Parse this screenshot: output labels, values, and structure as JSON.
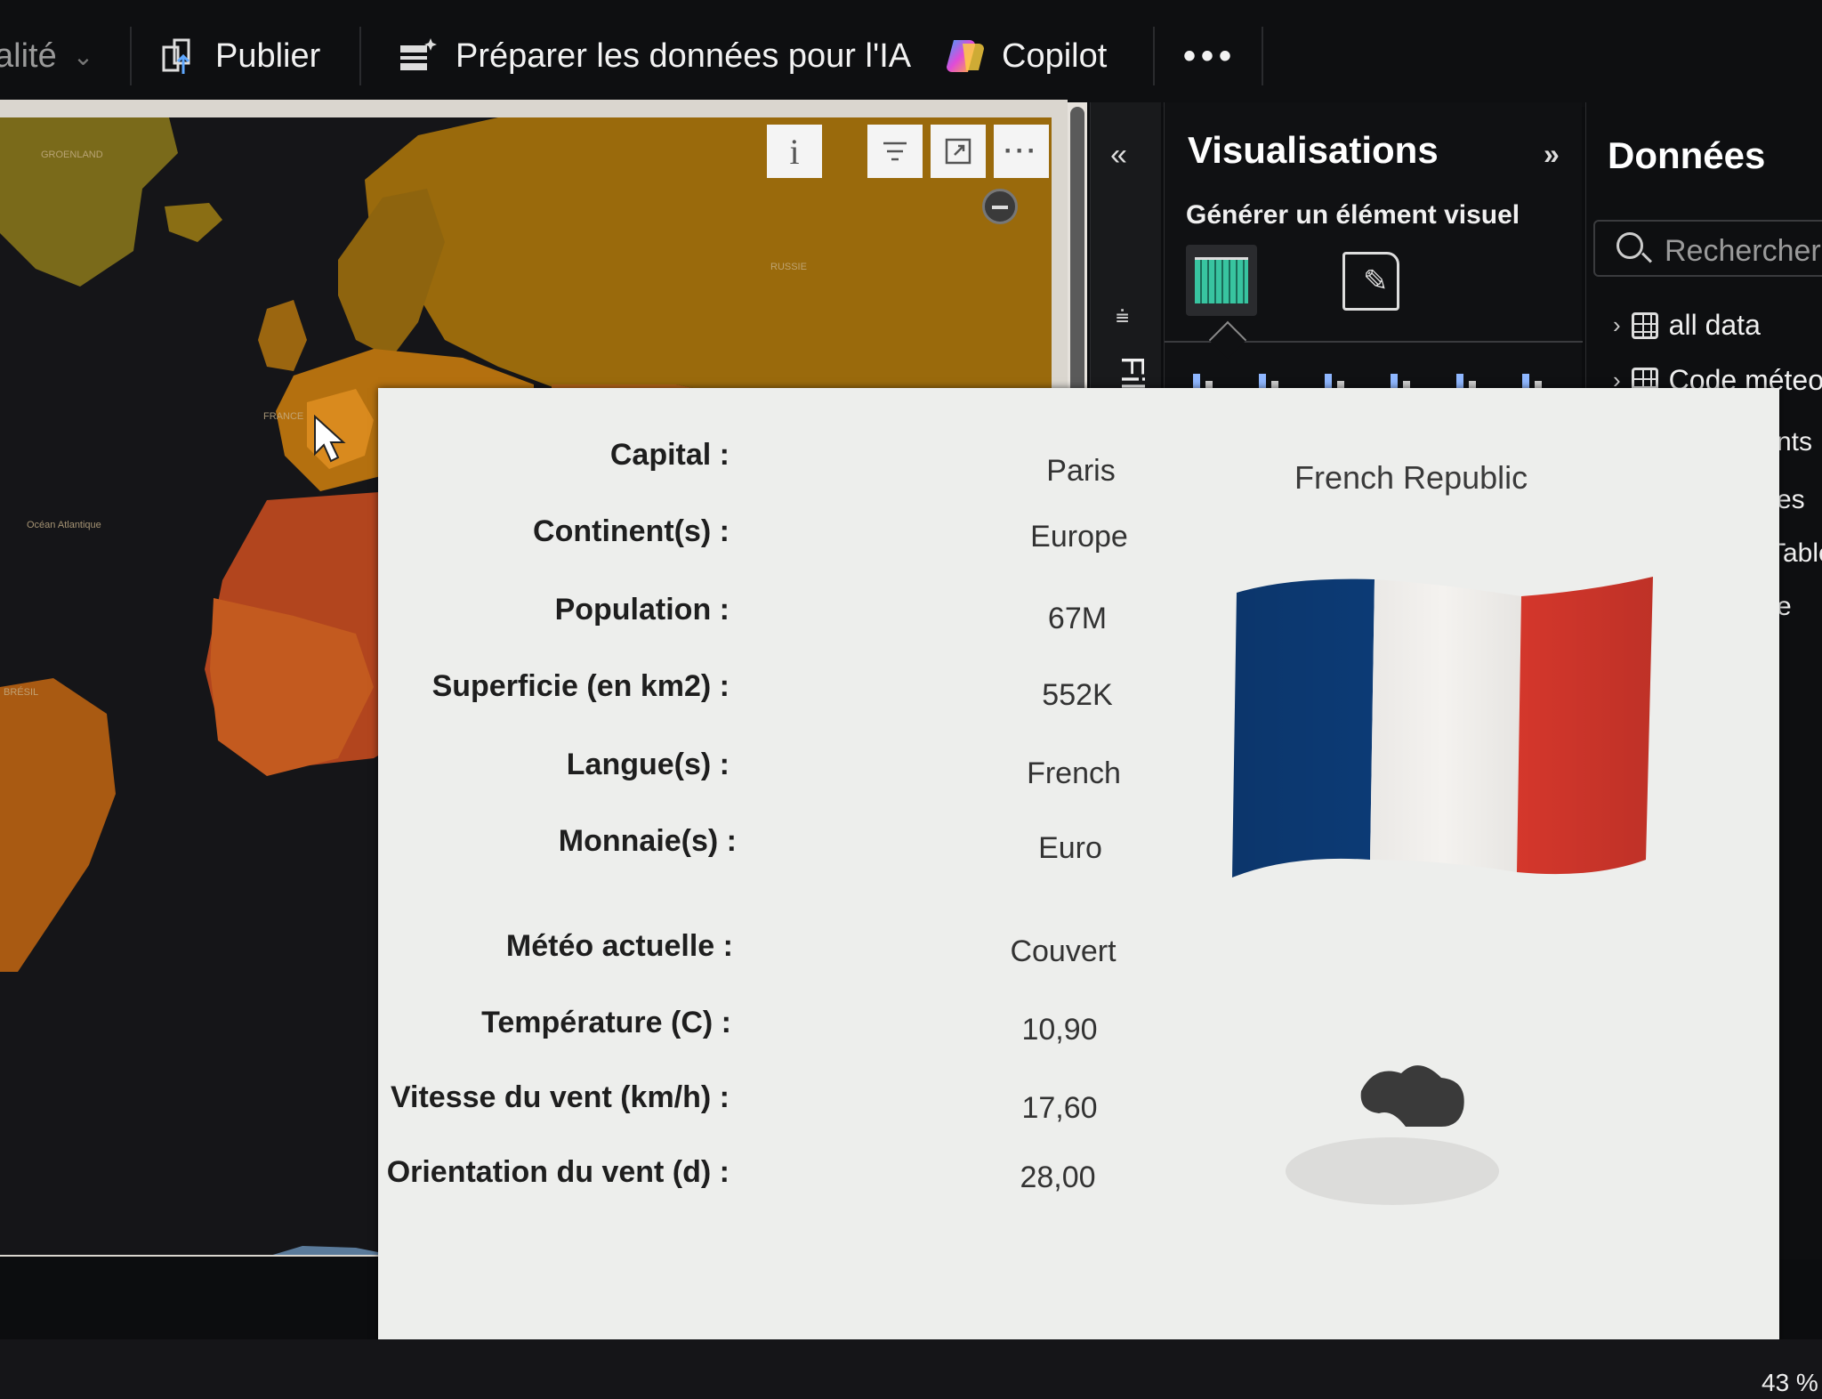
{
  "ribbon": {
    "partial_left_label": "alité",
    "publish_label": "Publier",
    "prepare_label": "Préparer les données pour l'IA",
    "copilot_label": "Copilot",
    "more_label": "•••"
  },
  "map": {
    "toolbar_info": "i"
  },
  "filters": {
    "collapse_glyph": "«",
    "label": "Filtres"
  },
  "visualizations": {
    "title": "Visualisations",
    "expand_glyph": "»",
    "subtitle": "Générer un élément visuel"
  },
  "data_pane": {
    "title": "Données",
    "search_placeholder": "Rechercher",
    "items": [
      {
        "label": "all data",
        "icon": "table-icon"
      },
      {
        "label": "Code méteo",
        "icon": "table-icon"
      }
    ],
    "partial_labels": [
      "nts",
      "es",
      "Table",
      "e"
    ]
  },
  "tooltip": {
    "country_name": "French Republic",
    "fields": [
      {
        "label": "Capital :",
        "value": "Paris"
      },
      {
        "label": "Continent(s) :",
        "value": "Europe"
      },
      {
        "label": "Population :",
        "value": "67M"
      },
      {
        "label": "Superficie (en km2) :",
        "value": "552K"
      },
      {
        "label": "Langue(s) :",
        "value": "French"
      },
      {
        "label": "Monnaie(s) :",
        "value": "Euro"
      },
      {
        "label": "Météo actuelle :",
        "value": "Couvert"
      },
      {
        "label": "Température (C) :",
        "value": "10,90"
      },
      {
        "label": "Vitesse du vent (km/h) :",
        "value": "17,60"
      },
      {
        "label": "Orientation du vent (d) :",
        "value": "28,00"
      }
    ],
    "flag_colors": {
      "blue": "#0d3d7a",
      "white": "#f4f2ef",
      "red": "#e03a2e"
    },
    "weather_icon": "cloud-icon"
  },
  "status": {
    "zoom": "43 %"
  }
}
